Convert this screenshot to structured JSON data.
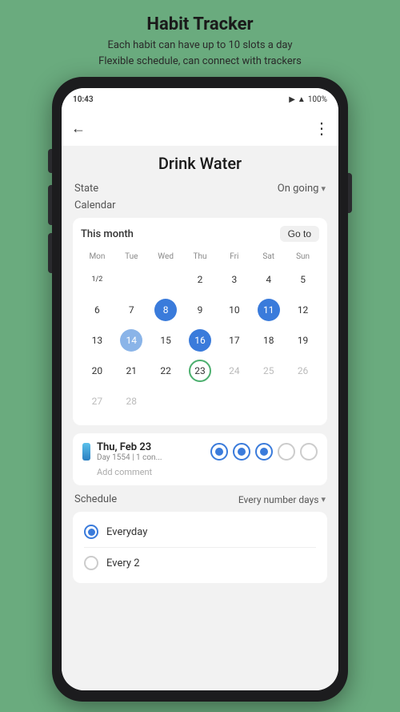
{
  "header": {
    "title": "Habit Tracker",
    "subtitle_line1": "Each habit can have up to 10 slots a day",
    "subtitle_line2": "Flexible schedule, can connect with trackers"
  },
  "status_bar": {
    "time": "10:43",
    "battery": "100%"
  },
  "app_bar": {
    "back_label": "←",
    "more_label": "⋮"
  },
  "habit": {
    "title": "Drink Water",
    "state_label": "State",
    "state_value": "On going",
    "calendar_label": "Calendar"
  },
  "calendar": {
    "month_label": "This month",
    "goto_label": "Go to",
    "day_headers": [
      "Mon",
      "Tue",
      "Wed",
      "Thu",
      "Fri",
      "Sat",
      "Sun"
    ],
    "rows": [
      [
        {
          "num": "1/2",
          "style": "small-text"
        },
        {
          "num": "",
          "style": ""
        },
        {
          "num": "",
          "style": ""
        },
        {
          "num": "2",
          "style": "normal"
        },
        {
          "num": "3",
          "style": "normal"
        },
        {
          "num": "4",
          "style": "normal"
        },
        {
          "num": "5",
          "style": "normal"
        }
      ],
      [
        {
          "num": "6",
          "style": "normal"
        },
        {
          "num": "7",
          "style": "normal"
        },
        {
          "num": "8",
          "style": "filled-dark"
        },
        {
          "num": "9",
          "style": "normal"
        },
        {
          "num": "10",
          "style": "normal"
        },
        {
          "num": "11",
          "style": "filled-dark"
        },
        {
          "num": "12",
          "style": "normal"
        }
      ],
      [
        {
          "num": "13",
          "style": "normal"
        },
        {
          "num": "14",
          "style": "filled-medium"
        },
        {
          "num": "15",
          "style": "normal"
        },
        {
          "num": "16",
          "style": "filled-dark"
        },
        {
          "num": "17",
          "style": "normal"
        },
        {
          "num": "18",
          "style": "normal"
        },
        {
          "num": "19",
          "style": "normal"
        }
      ],
      [
        {
          "num": "20",
          "style": "normal"
        },
        {
          "num": "21",
          "style": "normal"
        },
        {
          "num": "22",
          "style": "normal"
        },
        {
          "num": "23",
          "style": "today-outline"
        },
        {
          "num": "24",
          "style": "grey-text"
        },
        {
          "num": "25",
          "style": "grey-text"
        },
        {
          "num": "26",
          "style": "grey-text"
        }
      ],
      [
        {
          "num": "27",
          "style": "grey-text"
        },
        {
          "num": "28",
          "style": "grey-text"
        },
        {
          "num": "",
          "style": ""
        },
        {
          "num": "",
          "style": ""
        },
        {
          "num": "",
          "style": ""
        },
        {
          "num": "",
          "style": ""
        },
        {
          "num": "",
          "style": ""
        }
      ]
    ]
  },
  "day_detail": {
    "date": "Thu, Feb 23",
    "sub": "Day 1554 | 1 con...",
    "slots": [
      "filled",
      "filled",
      "filled",
      "empty",
      "empty"
    ],
    "add_comment": "Add comment"
  },
  "schedule": {
    "label": "Schedule",
    "value": "Every number days",
    "options": [
      {
        "label": "Everyday",
        "selected": true
      },
      {
        "label": "Every 2",
        "selected": false
      }
    ]
  }
}
